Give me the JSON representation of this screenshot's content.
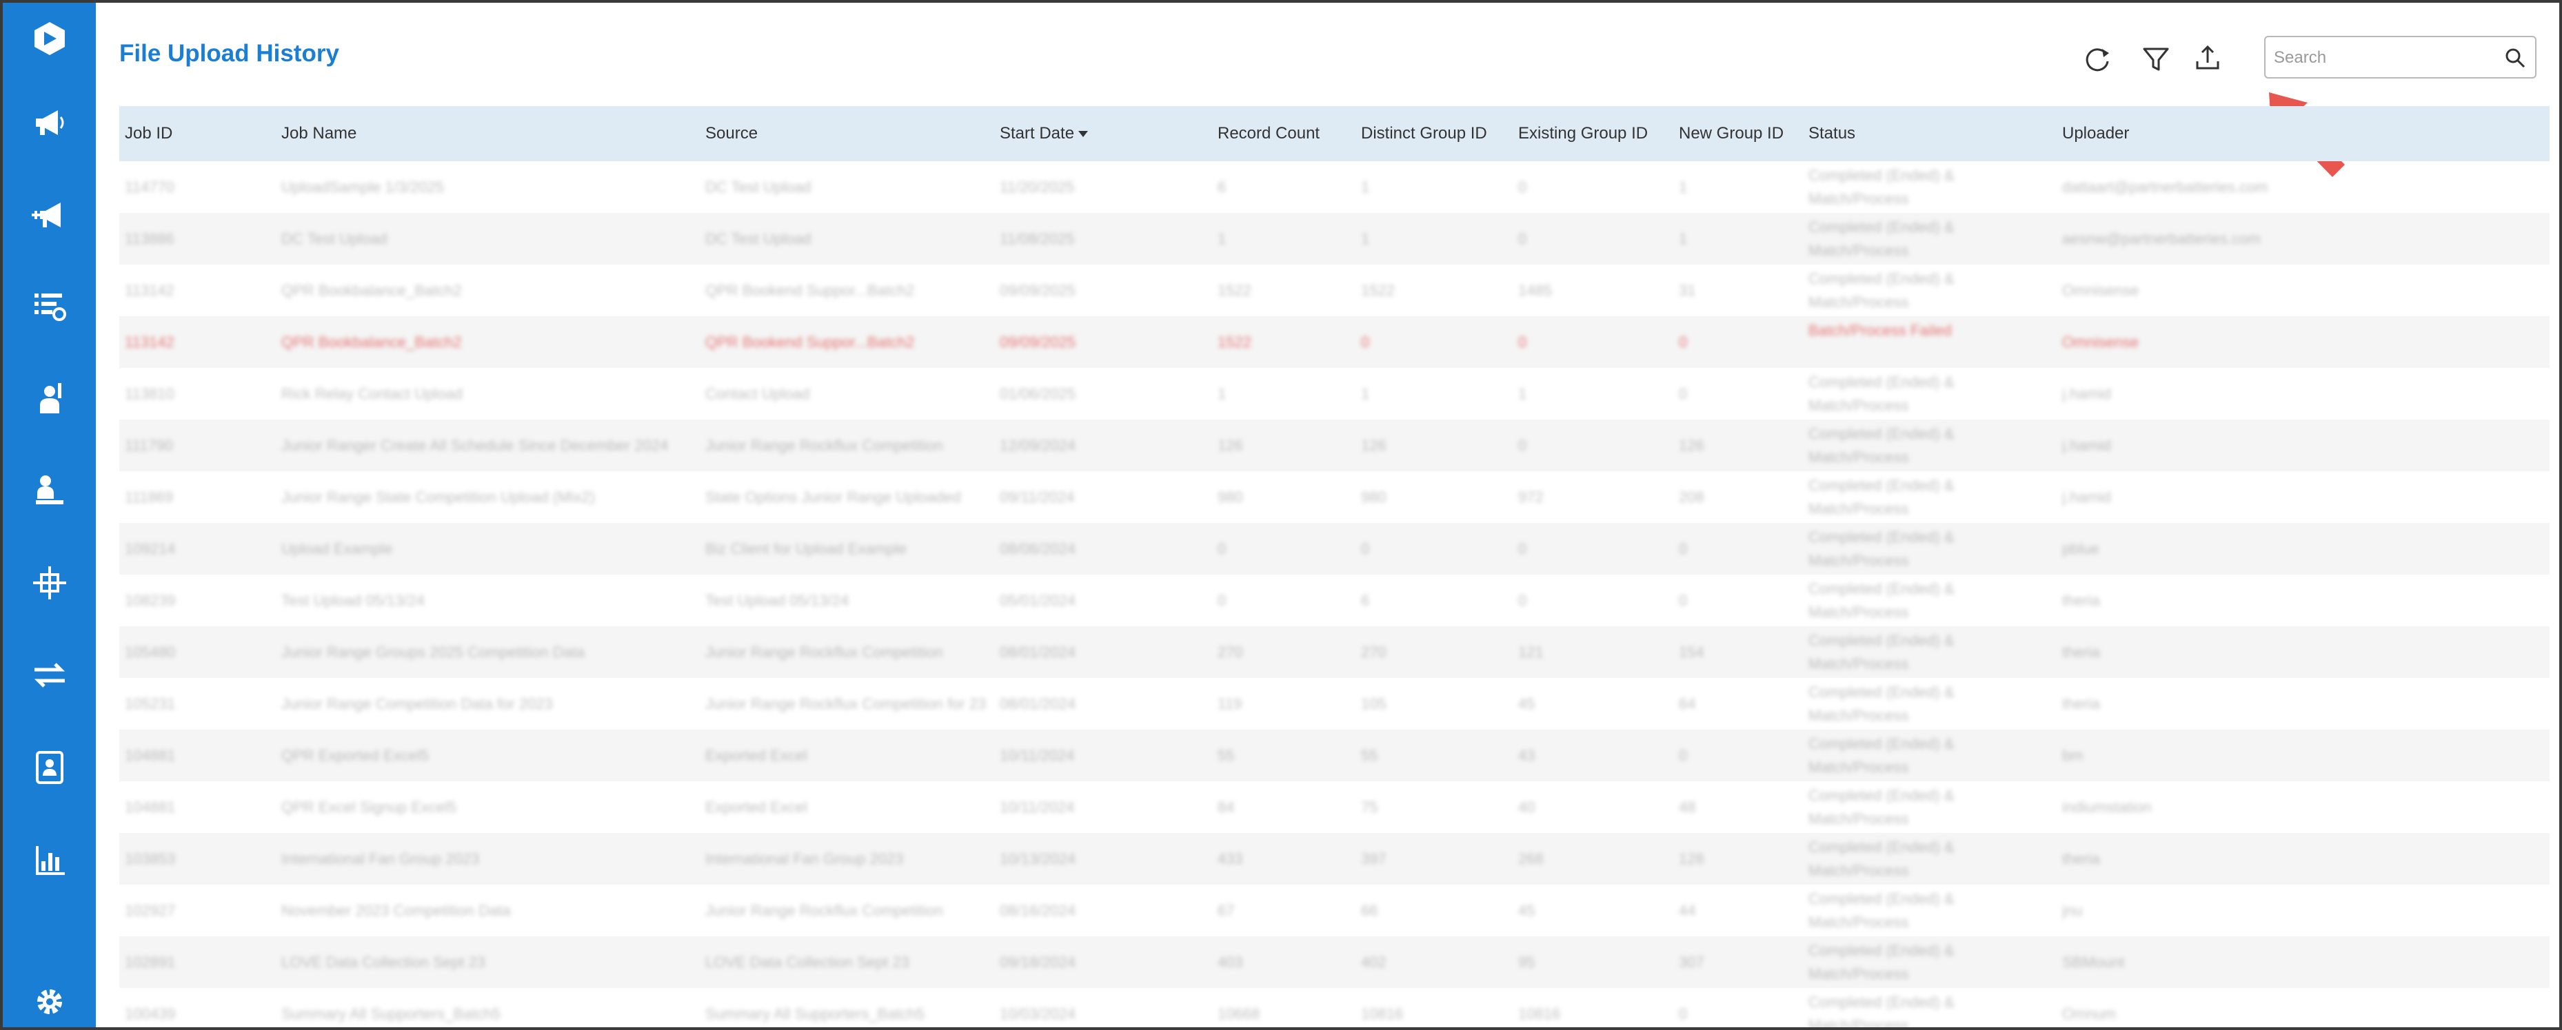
{
  "page": {
    "title": "File Upload History"
  },
  "sidebar": {
    "items": [
      {
        "icon": "logo-icon"
      },
      {
        "icon": "megaphone-icon"
      },
      {
        "icon": "megaphone-plus-icon"
      },
      {
        "icon": "list-settings-icon"
      },
      {
        "icon": "person-raise-hand-icon"
      },
      {
        "icon": "person-desk-icon"
      },
      {
        "icon": "sparkle-grid-icon"
      },
      {
        "icon": "transfer-arrows-icon"
      },
      {
        "icon": "contact-card-icon"
      },
      {
        "icon": "bar-chart-icon"
      },
      {
        "icon": "gear-icon"
      }
    ]
  },
  "toolbar": {
    "refresh_icon": "refresh-icon",
    "filter_icon": "filter-icon",
    "export_icon": "upload-icon",
    "search_placeholder": "Search"
  },
  "colors": {
    "accent": "#1a7fd4",
    "header_bg": "#deeaf4",
    "arrow": "#e8574f",
    "error_text": "#e04848"
  },
  "table": {
    "columns": [
      "Job ID",
      "Job Name",
      "Source",
      "Start Date",
      "Record Count",
      "Distinct Group ID",
      "Existing Group ID",
      "New Group ID",
      "Status",
      "Uploader"
    ],
    "sort": {
      "column": "Start Date",
      "direction": "desc"
    },
    "rows": [
      [
        "114770",
        "UploadSample 1/3/2025",
        "DC Test Upload",
        "11/20/2025",
        "6",
        "1",
        "0",
        "1",
        "Completed (Ended) & Match/Process",
        "dattaart@partnerbatteries.com"
      ],
      [
        "113886",
        "DC Test Upload",
        "DC Test Upload",
        "11/08/2025",
        "1",
        "1",
        "0",
        "1",
        "Completed (Ended) & Match/Process",
        "aesnw@partnerbatteries.com"
      ],
      [
        "113142",
        "QPR Bookbalance_Batch2",
        "QPR Bookend Suppor...Batch2",
        "09/09/2025",
        "1522",
        "1522",
        "1485",
        "31",
        "Completed (Ended) & Match/Process",
        "Omnisense"
      ],
      [
        "113142",
        "QPR Bookbalance_Batch2",
        "QPR Bookend Suppor...Batch2",
        "09/09/2025",
        "1522",
        "0",
        "0",
        "0",
        "Batch/Process Failed",
        "Omnisense"
      ],
      [
        "113810",
        "Rick Relay Contact Upload",
        "Contact Upload",
        "01/06/2025",
        "1",
        "1",
        "1",
        "0",
        "Completed (Ended) & Match/Process",
        "j.hamid"
      ],
      [
        "111790",
        "Junior Ranger Create All Schedule Since December 2024",
        "Junior Range Rockflux Competition",
        "12/09/2024",
        "126",
        "126",
        "0",
        "126",
        "Completed (Ended) & Match/Process",
        "j.hamid"
      ],
      [
        "111869",
        "Junior Range State Competition Upload (Mix2)",
        "State Options Junior Range Uploaded",
        "09/11/2024",
        "980",
        "980",
        "972",
        "208",
        "Completed (Ended) & Match/Process",
        "j.hamid"
      ],
      [
        "109214",
        "Upload Example",
        "Biz Client for Upload Example",
        "08/06/2024",
        "0",
        "0",
        "0",
        "0",
        "Completed (Ended) & Match/Process",
        "pblue"
      ],
      [
        "108239",
        "Test Upload 05/13/24",
        "Test Upload 05/13/24",
        "05/01/2024",
        "0",
        "6",
        "0",
        "0",
        "Completed (Ended) & Match/Process",
        "theria"
      ],
      [
        "105480",
        "Junior Range Groups 2025 Competition Data",
        "Junior Range Rockflux Competition",
        "08/01/2024",
        "270",
        "270",
        "121",
        "154",
        "Completed (Ended) & Match/Process",
        "theria"
      ],
      [
        "105231",
        "Junior Range Competition Data for 2023",
        "Junior Range Rockflux Competition for 23",
        "08/01/2024",
        "119",
        "105",
        "45",
        "64",
        "Completed (Ended) & Match/Process",
        "theria"
      ],
      [
        "104881",
        "QPR Exported Excel5",
        "Exported Excel",
        "10/11/2024",
        "55",
        "55",
        "43",
        "0",
        "Completed (Ended) & Match/Process",
        "bm"
      ],
      [
        "104881",
        "QPR Excel Signup Excel5",
        "Exported Excel",
        "10/11/2024",
        "84",
        "75",
        "40",
        "48",
        "Completed (Ended) & Match/Process",
        "indiumstation"
      ],
      [
        "103853",
        "International Fan Group 2023",
        "International Fan Group 2023",
        "10/13/2024",
        "433",
        "397",
        "268",
        "128",
        "Completed (Ended) & Match/Process",
        "theria"
      ],
      [
        "102927",
        "November 2023 Competition Data",
        "Junior Range Rockflux Competition",
        "08/16/2024",
        "67",
        "66",
        "45",
        "44",
        "Completed (Ended) & Match/Process",
        "jnu"
      ],
      [
        "102891",
        "LOVE Data Collection Sept 23",
        "LOVE Data Collection Sept 23",
        "09/18/2024",
        "403",
        "402",
        "95",
        "307",
        "Completed (Ended) & Match/Process",
        "SBMount"
      ],
      [
        "100439",
        "Summary All Supporters_Batch5",
        "Summary All Supporters_Batch5",
        "10/03/2024",
        "10668",
        "10816",
        "10816",
        "0",
        "Completed (Ended) & Match/Process",
        "Omnum"
      ]
    ]
  }
}
